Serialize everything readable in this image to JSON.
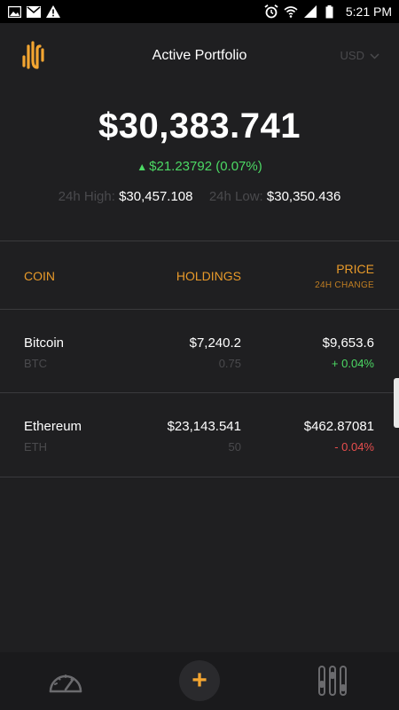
{
  "status_bar": {
    "time": "5:21 PM"
  },
  "header": {
    "title": "Active Portfolio",
    "currency": "USD"
  },
  "summary": {
    "total": "$30,383.741",
    "change": "$21.23792 (0.07%)",
    "high_label": "24h High:",
    "high_value": "$30,457.108",
    "low_label": "24h Low:",
    "low_value": "$30,350.436"
  },
  "table": {
    "col_coin": "COIN",
    "col_holdings": "HOLDINGS",
    "col_price": "PRICE",
    "col_price_sub": "24H CHANGE",
    "rows": [
      {
        "name": "Bitcoin",
        "symbol": "BTC",
        "holdings": "$7,240.2",
        "quantity": "0.75",
        "price": "$9,653.6",
        "change": "+ 0.04%"
      },
      {
        "name": "Ethereum",
        "symbol": "ETH",
        "holdings": "$23,143.541",
        "quantity": "50",
        "price": "$462.87081",
        "change": "- 0.04%"
      }
    ]
  },
  "colors": {
    "accent": "#e89a2a",
    "positive": "#4cd964",
    "negative": "#e94e4e",
    "background": "#1f1f21"
  },
  "bottom_nav": {
    "add_label": "+",
    "icons": [
      "gauge-icon",
      "plus-icon",
      "sliders-icon"
    ]
  }
}
